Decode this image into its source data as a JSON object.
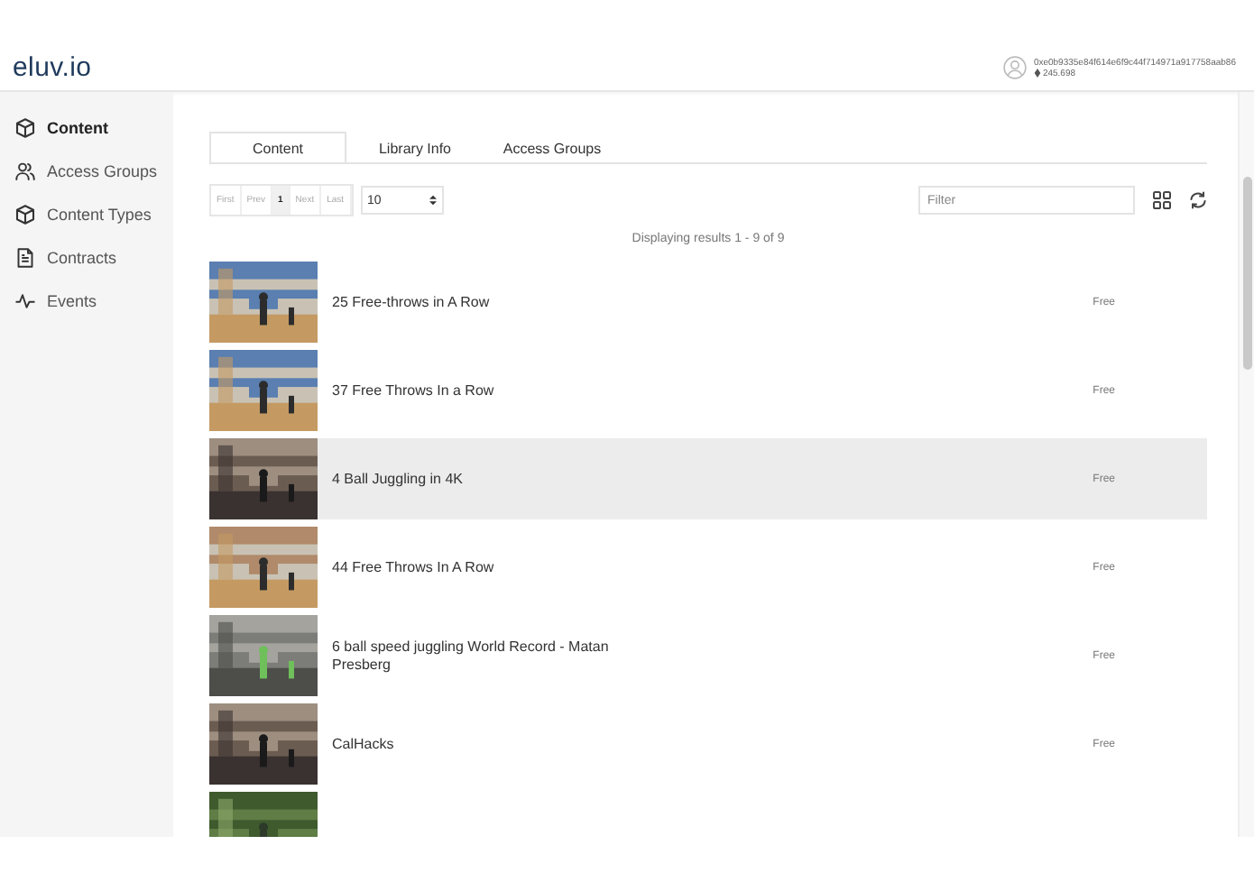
{
  "header": {
    "logo": "eluv.io",
    "account": {
      "address": "0xe0b9335e84f614e6f9c44f714971a917758aab86",
      "balance": "245.698"
    }
  },
  "sidebar": {
    "items": [
      {
        "label": "Content",
        "selected": true
      },
      {
        "label": "Access Groups",
        "selected": false
      },
      {
        "label": "Content Types",
        "selected": false
      },
      {
        "label": "Contracts",
        "selected": false
      },
      {
        "label": "Events",
        "selected": false
      }
    ]
  },
  "tabs": [
    {
      "label": "Content",
      "selected": true
    },
    {
      "label": "Library Info",
      "selected": false
    },
    {
      "label": "Access Groups",
      "selected": false
    }
  ],
  "pagination": {
    "buttons": [
      {
        "label": "First",
        "selected": false
      },
      {
        "label": "Prev",
        "selected": false
      },
      {
        "label": "1",
        "selected": true
      },
      {
        "label": "Next",
        "selected": false
      },
      {
        "label": "Last",
        "selected": false
      }
    ],
    "per_page": "10"
  },
  "filter": {
    "placeholder": "Filter"
  },
  "results_text": "Displaying results 1 - 9 of 9",
  "rows": [
    {
      "kind": "item",
      "title": "25 Free-throws in A Row",
      "price": "Free",
      "selected": false
    },
    {
      "kind": "item",
      "title": "37 Free Throws In a Row",
      "price": "Free",
      "selected": false
    },
    {
      "kind": "item",
      "title": "4 Ball Juggling in 4K",
      "price": "Free",
      "selected": true
    },
    {
      "kind": "item",
      "title": "44 Free Throws In A Row",
      "price": "Free",
      "selected": false
    },
    {
      "kind": "item",
      "title": "6 ball speed juggling World Record - Matan Presberg",
      "price": "Free",
      "selected": false
    },
    {
      "kind": "item",
      "title": "CalHacks",
      "price": "Free",
      "selected": false
    },
    {
      "kind": "picture"
    }
  ]
}
